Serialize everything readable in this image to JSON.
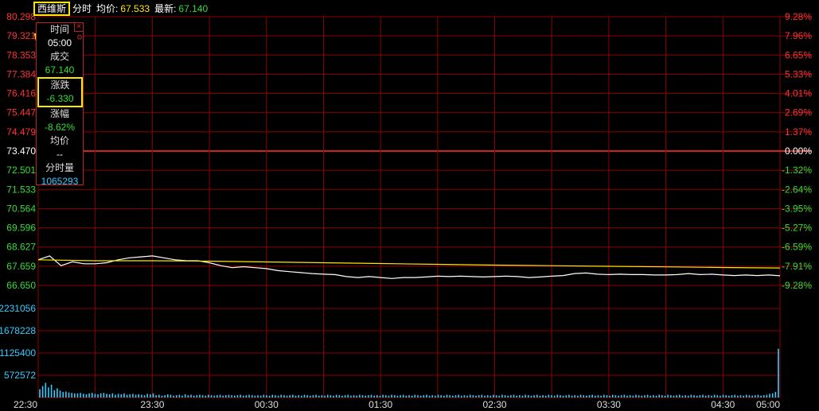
{
  "header": {
    "stock_name": "西维斯",
    "mode_label": "分时",
    "avg_label": "均价:",
    "avg_value": "67.533",
    "latest_label": "最新:",
    "latest_value": "67.140"
  },
  "tooltip": {
    "time_label": "时间",
    "time_value": "05:00",
    "volume_label": "成交",
    "volume_value": "67.140",
    "change_label": "涨跌",
    "change_value": "-6.330",
    "pct_label": "涨幅",
    "pct_value": "-8.62%",
    "avg_label": "均价",
    "avg_value": "--",
    "minute_vol_label": "分时量",
    "minute_vol_value": "1065293",
    "close_icon": "close-icon",
    "settings_icon": "gear-icon"
  },
  "colors": {
    "grid": "#8b0000",
    "up": "#ff3333",
    "down": "#33dd33",
    "neutral": "#ffffff",
    "price_line": "#ffffff",
    "avg_line": "#ffe600",
    "volume": "#33ccff",
    "highlight": "#ffe600"
  },
  "chart_data": [
    {
      "type": "line",
      "subtype": "intraday_minute",
      "prev_close": 73.47,
      "y_left_ticks": [
        "80.298",
        "79.321",
        "78.353",
        "77.384",
        "76.416",
        "75.447",
        "74.479",
        "73.470",
        "72.501",
        "71.533",
        "70.564",
        "69.596",
        "68.627",
        "67.659",
        "66.650"
      ],
      "y_right_ticks": [
        "9.28%",
        "7.96%",
        "6.65%",
        "5.33%",
        "4.01%",
        "2.69%",
        "1.37%",
        "0.00%",
        "-1.32%",
        "-2.64%",
        "-3.95%",
        "-5.27%",
        "-6.59%",
        "-7.91%",
        "-9.28%"
      ],
      "ylim": [
        66.65,
        80.298
      ],
      "x_ticks": [
        "22:30",
        "23:30",
        "00:30",
        "01:30",
        "02:30",
        "03:30",
        "04:30",
        "05:00"
      ],
      "series": [
        {
          "role": "price",
          "x": [
            "22:30",
            "22:36",
            "22:42",
            "22:48",
            "22:54",
            "23:00",
            "23:06",
            "23:12",
            "23:18",
            "23:24",
            "23:30",
            "23:36",
            "23:42",
            "23:48",
            "23:54",
            "00:00",
            "00:06",
            "00:12",
            "00:18",
            "00:24",
            "00:30",
            "00:36",
            "00:42",
            "00:48",
            "00:54",
            "01:00",
            "01:06",
            "01:12",
            "01:18",
            "01:24",
            "01:30",
            "01:36",
            "01:42",
            "01:48",
            "01:54",
            "02:00",
            "02:06",
            "02:12",
            "02:18",
            "02:24",
            "02:30",
            "02:36",
            "02:42",
            "02:48",
            "02:54",
            "03:00",
            "03:06",
            "03:12",
            "03:18",
            "03:24",
            "03:30",
            "03:36",
            "03:42",
            "03:48",
            "03:54",
            "04:00",
            "04:06",
            "04:12",
            "04:18",
            "04:24",
            "04:30",
            "04:36",
            "04:42",
            "04:48",
            "04:54",
            "05:00"
          ],
          "values": [
            67.95,
            68.15,
            67.65,
            67.85,
            67.75,
            67.75,
            67.8,
            67.95,
            68.05,
            68.1,
            68.15,
            68.05,
            67.95,
            67.9,
            67.9,
            67.8,
            67.65,
            67.55,
            67.6,
            67.55,
            67.5,
            67.4,
            67.35,
            67.3,
            67.25,
            67.22,
            67.2,
            67.1,
            67.05,
            67.1,
            67.05,
            67.0,
            67.05,
            67.05,
            67.08,
            67.12,
            67.1,
            67.12,
            67.1,
            67.08,
            67.1,
            67.12,
            67.1,
            67.05,
            67.08,
            67.12,
            67.15,
            67.25,
            67.28,
            67.22,
            67.2,
            67.22,
            67.2,
            67.2,
            67.18,
            67.18,
            67.2,
            67.25,
            67.2,
            67.22,
            67.18,
            67.15,
            67.18,
            67.15,
            67.18,
            67.14
          ]
        },
        {
          "role": "average",
          "x": [
            "22:30",
            "23:00",
            "23:30",
            "00:00",
            "00:30",
            "01:00",
            "01:30",
            "02:00",
            "02:30",
            "03:00",
            "03:30",
            "04:00",
            "04:30",
            "05:00"
          ],
          "values": [
            67.95,
            67.9,
            67.9,
            67.88,
            67.84,
            67.8,
            67.76,
            67.72,
            67.68,
            67.65,
            67.62,
            67.59,
            67.56,
            67.533
          ]
        }
      ]
    },
    {
      "type": "bar",
      "role": "minute_volume",
      "y_ticks": [
        "2231056",
        "1678228",
        "1125400",
        "572572"
      ],
      "ylim": [
        0,
        2450000
      ],
      "x_ticks": [
        "22:30",
        "23:30",
        "00:30",
        "01:30",
        "02:30",
        "03:30",
        "04:30",
        "05:00"
      ],
      "values": [
        180000,
        250000,
        320000,
        220000,
        280000,
        160000,
        200000,
        150000,
        120000,
        130000,
        110000,
        100000,
        90000,
        90000,
        100000,
        80000,
        70000,
        90000,
        100000,
        80000,
        70000,
        90000,
        100000,
        80000,
        70000,
        90000,
        60000,
        80000,
        70000,
        90000,
        60000,
        70000,
        80000,
        60000,
        70000,
        60000,
        50000,
        80000,
        70000,
        90000,
        50000,
        60000,
        40000,
        50000,
        70000,
        60000,
        40000,
        50000,
        60000,
        40000,
        70000,
        50000,
        60000,
        40000,
        50000,
        60000,
        50000,
        40000,
        60000,
        50000,
        40000,
        50000,
        60000,
        40000,
        50000,
        60000,
        50000,
        40000,
        50000,
        60000,
        40000,
        50000,
        60000,
        50000,
        40000,
        50000,
        40000,
        60000,
        50000,
        40000,
        60000,
        50000,
        40000,
        60000,
        50000,
        40000,
        50000,
        60000,
        40000,
        50000,
        40000,
        60000,
        50000,
        40000,
        50000,
        60000,
        40000,
        50000,
        40000,
        60000,
        50000,
        40000,
        60000,
        50000,
        40000,
        50000,
        60000,
        40000,
        50000,
        40000,
        60000,
        50000,
        40000,
        50000,
        60000,
        40000,
        50000,
        40000,
        60000,
        50000,
        40000,
        60000,
        50000,
        40000,
        50000,
        60000,
        40000,
        50000,
        40000,
        60000,
        50000,
        40000,
        50000,
        60000,
        40000,
        50000,
        40000,
        60000,
        50000,
        40000,
        60000,
        50000,
        40000,
        50000,
        60000,
        40000,
        50000,
        40000,
        60000,
        50000,
        40000,
        50000,
        60000,
        40000,
        50000,
        40000,
        60000,
        50000,
        40000,
        60000,
        50000,
        40000,
        50000,
        60000,
        40000,
        50000,
        40000,
        60000,
        50000,
        40000,
        50000,
        60000,
        40000,
        50000,
        40000,
        60000,
        50000,
        40000,
        60000,
        50000,
        40000,
        50000,
        60000,
        40000,
        50000,
        40000,
        60000,
        50000,
        40000,
        50000,
        60000,
        40000,
        50000,
        40000,
        60000,
        50000,
        40000,
        60000,
        50000,
        40000,
        50000,
        60000,
        40000,
        50000,
        40000,
        60000,
        50000,
        40000,
        50000,
        60000,
        40000,
        50000,
        40000,
        60000,
        50000,
        40000,
        60000,
        50000,
        40000,
        50000,
        60000,
        40000,
        50000,
        40000,
        60000,
        50000,
        40000,
        50000,
        60000,
        40000,
        50000,
        40000,
        60000,
        50000,
        40000,
        60000,
        50000,
        40000,
        50000,
        60000,
        40000,
        50000,
        40000,
        60000,
        50000,
        40000,
        50000,
        60000,
        40000,
        50000,
        60000,
        80000,
        90000,
        120000,
        1065293
      ]
    }
  ]
}
